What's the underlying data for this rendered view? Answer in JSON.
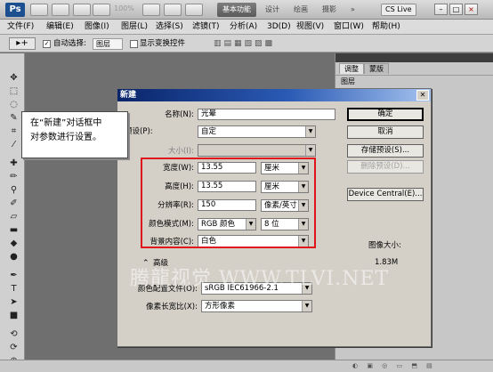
{
  "app": {
    "logo": "Ps",
    "zoom": "100%",
    "workspaces": [
      "基本功能",
      "设计",
      "绘画",
      "摄影"
    ],
    "cs_live": "CS Live",
    "window_buttons": [
      "–",
      "□",
      "×"
    ]
  },
  "menu": [
    "文件(F)",
    "编辑(E)",
    "图像(I)",
    "图层(L)",
    "选择(S)",
    "滤镜(T)",
    "分析(A)",
    "3D(D)",
    "视图(V)",
    "窗口(W)",
    "帮助(H)"
  ],
  "options": {
    "auto_select": "自动选择:",
    "auto_select_value": "图层",
    "show_transform": "显示变换控件"
  },
  "panels": {
    "tabs": [
      "调整",
      "蒙版"
    ],
    "items": [
      "图层"
    ]
  },
  "callout": {
    "line1": "在“新建”对话框中",
    "line2": "对参数进行设置。"
  },
  "dialog": {
    "title": "新建",
    "name_label": "名称(N):",
    "name_value": "光晕",
    "preset_label": "预设(P):",
    "preset_value": "自定",
    "size_label": "大小(I):",
    "width_label": "宽度(W):",
    "width_value": "13.55",
    "width_unit": "厘米",
    "height_label": "高度(H):",
    "height_value": "13.55",
    "height_unit": "厘米",
    "res_label": "分辨率(R):",
    "res_value": "150",
    "res_unit": "像素/英寸",
    "mode_label": "颜色模式(M):",
    "mode_value": "RGB 颜色",
    "bits_value": "8 位",
    "bg_label": "背景内容(C):",
    "bg_value": "白色",
    "advanced_label": "高级",
    "profile_label": "颜色配置文件(O):",
    "profile_value": "sRGB IEC61966-2.1",
    "aspect_label": "像素长宽比(X):",
    "aspect_value": "方形像素",
    "ok": "确定",
    "cancel": "取消",
    "save_preset": "存储预设(S)...",
    "delete_preset": "删除预设(D)...",
    "device_central": "Device Central(E)...",
    "image_size_label": "图像大小:",
    "image_size_value": "1.83M"
  },
  "watermark": "腾龍视觉 WWW.TLVI.NET"
}
